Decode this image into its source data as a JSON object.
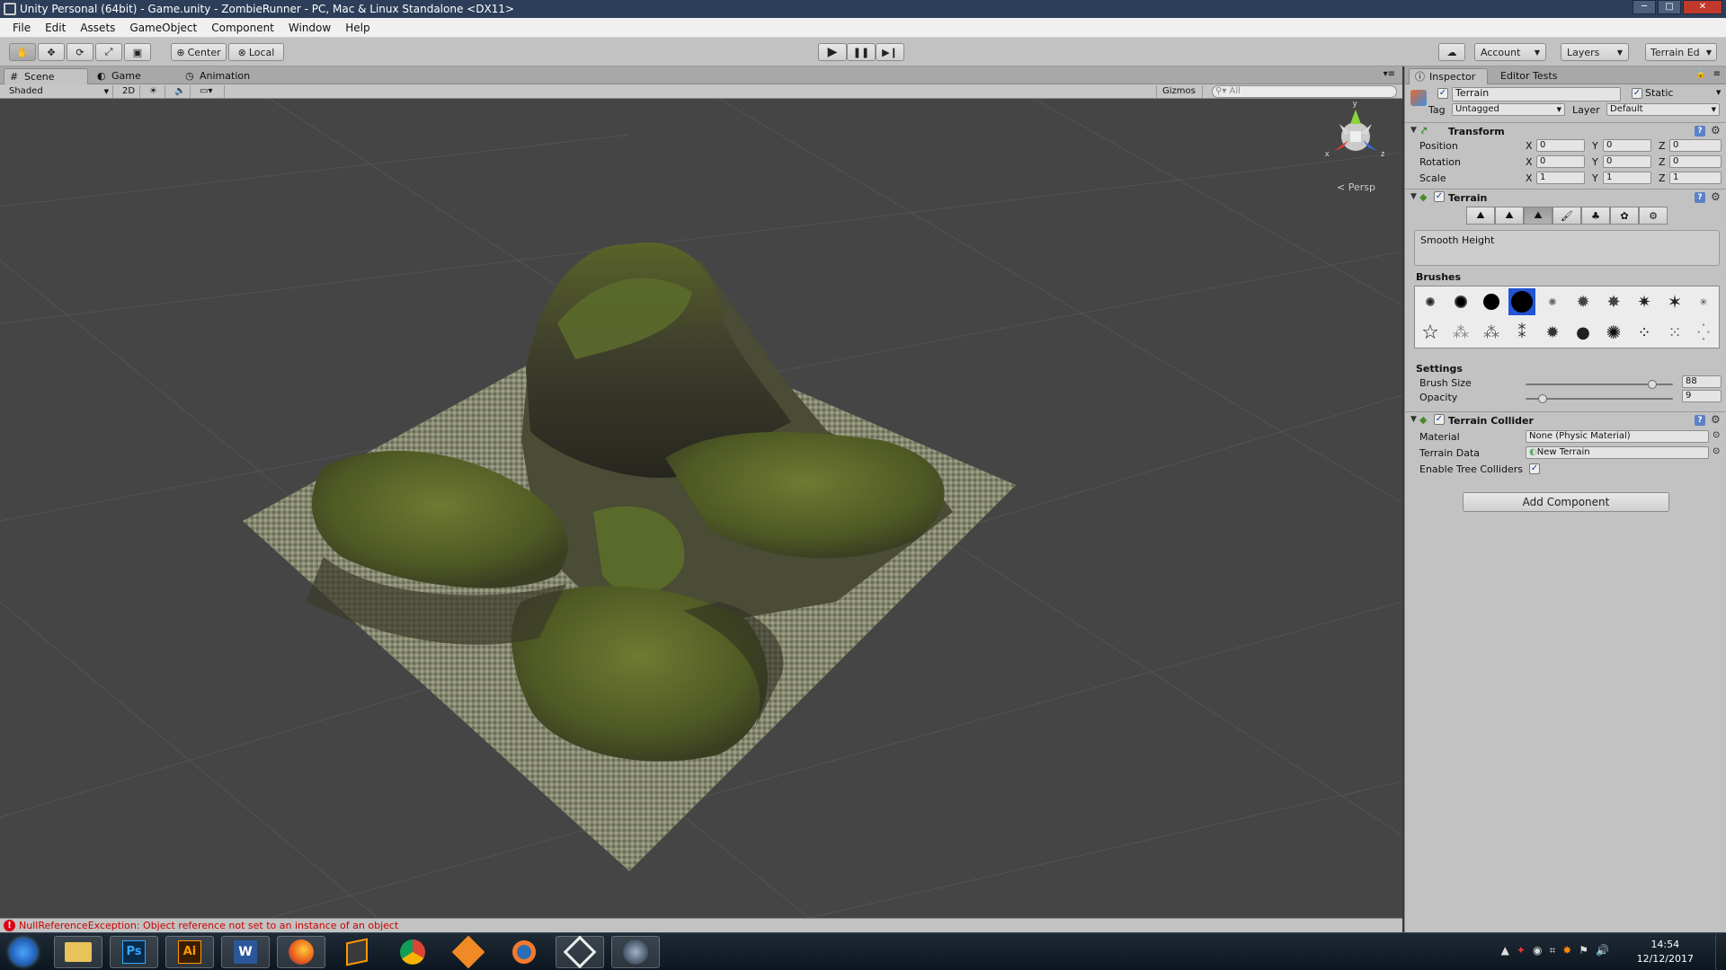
{
  "window": {
    "title": "Unity Personal (64bit) - Game.unity - ZombieRunner - PC, Mac & Linux Standalone <DX11>"
  },
  "menu": [
    "File",
    "Edit",
    "Assets",
    "GameObject",
    "Component",
    "Window",
    "Help"
  ],
  "toolbar": {
    "pivot": "Center",
    "space": "Local",
    "account": "Account",
    "layers": "Layers",
    "layout": "Terrain Ed"
  },
  "scene_tabs": {
    "scene": "Scene",
    "game": "Game",
    "animation": "Animation"
  },
  "scene_bar": {
    "shading": "Shaded",
    "mode_2d": "2D",
    "gizmos": "Gizmos",
    "search_placeholder": "All"
  },
  "viewport": {
    "projection": "Persp",
    "axis_x": "x",
    "axis_y": "y",
    "axis_z": "z"
  },
  "inspector": {
    "tab": "Inspector",
    "tab2": "Editor Tests",
    "object_name": "Terrain",
    "static_label": "Static",
    "tag_label": "Tag",
    "tag_value": "Untagged",
    "layer_label": "Layer",
    "layer_value": "Default",
    "transform": {
      "title": "Transform",
      "position_label": "Position",
      "rotation_label": "Rotation",
      "scale_label": "Scale",
      "x": "X",
      "y": "Y",
      "z": "Z",
      "position": [
        "0",
        "0",
        "0"
      ],
      "rotation": [
        "0",
        "0",
        "0"
      ],
      "scale": [
        "1",
        "1",
        "1"
      ]
    },
    "terrain": {
      "title": "Terrain",
      "tool_desc": "Smooth Height",
      "brushes_label": "Brushes",
      "settings_label": "Settings",
      "brush_size_label": "Brush Size",
      "brush_size": "88",
      "brush_size_fraction": 0.88,
      "opacity_label": "Opacity",
      "opacity": "9",
      "opacity_fraction": 0.09
    },
    "collider": {
      "title": "Terrain Collider",
      "material_label": "Material",
      "material_value": "None (Physic Material)",
      "data_label": "Terrain Data",
      "data_value": "New Terrain",
      "tree_label": "Enable Tree Colliders"
    },
    "add_component": "Add Component"
  },
  "status": {
    "message": "NullReferenceException: Object reference not set to an instance of an object"
  },
  "taskbar": {
    "apps": [
      "start",
      "explorer",
      "photoshop",
      "illustrator",
      "word",
      "firefox",
      "sublime",
      "chrome",
      "blender-alt",
      "blender",
      "unity",
      "steam"
    ],
    "ps_label": "Ps",
    "ai_label": "Ai",
    "word_label": "W",
    "time": "14:54",
    "date": "12/12/2017"
  },
  "colors": {
    "titlebar": "#2c3e59",
    "panel": "#c2c2c2",
    "viewport": "#454545",
    "error": "#cc0000",
    "selected_brush": "#2255d4"
  }
}
